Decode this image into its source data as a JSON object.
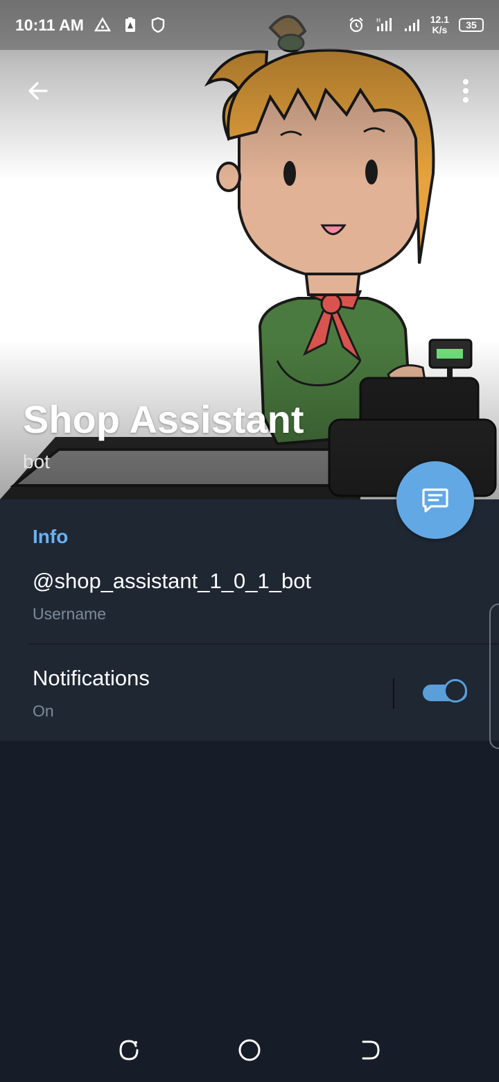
{
  "status_bar": {
    "time": "10:11 AM",
    "network_speed_value": "12.1",
    "network_speed_unit": "K/s",
    "battery_level": "35",
    "icons": [
      "location-triangle-icon",
      "battery-alert-icon",
      "shield-icon",
      "alarm-icon",
      "signal-hd-icon",
      "signal-icon"
    ]
  },
  "header": {
    "back_icon": "arrow-left-icon",
    "menu_icon": "more-vertical-icon",
    "title": "Shop Assistant",
    "subtitle": "bot"
  },
  "fab": {
    "icon": "message-icon"
  },
  "info_section": {
    "title": "Info",
    "username_value": "@shop_assistant_1_0_1_bot",
    "username_label": "Username",
    "notifications_title": "Notifications",
    "notifications_state": "On",
    "notifications_enabled": true
  },
  "nav_bar": {
    "icons": [
      "recent-apps-icon",
      "home-icon",
      "back-icon"
    ]
  },
  "colors": {
    "accent": "#6ab2f2",
    "fab": "#62a8e4",
    "panel": "#1f2733",
    "background": "#171d28",
    "secondary_text": "#7d8b99"
  }
}
